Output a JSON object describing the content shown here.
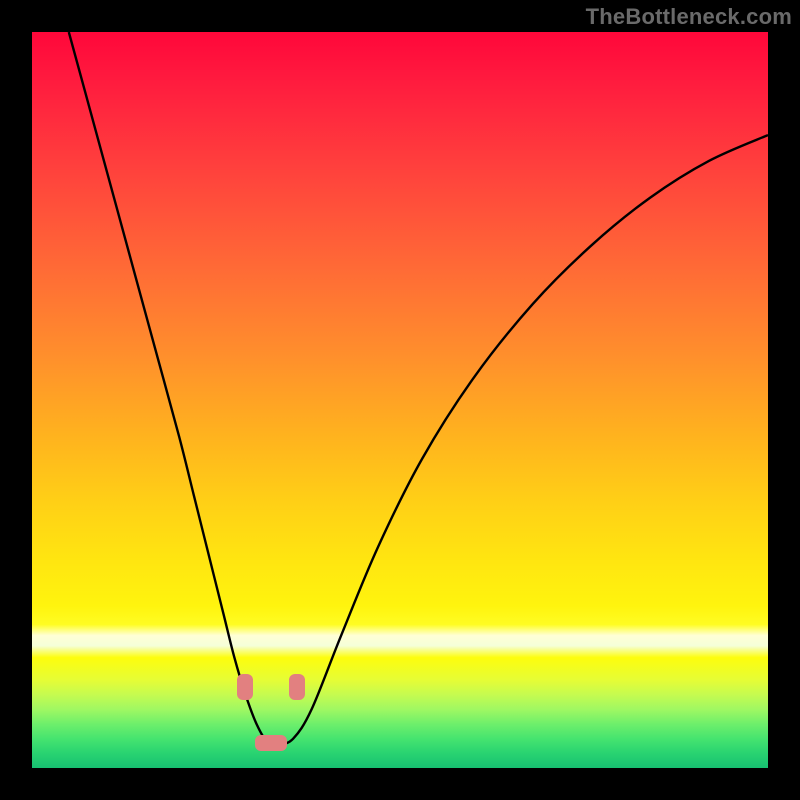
{
  "watermark": "TheBottleneck.com",
  "chart_data": {
    "type": "line",
    "title": "",
    "xlabel": "",
    "ylabel": "",
    "xlim": [
      0,
      100
    ],
    "ylim": [
      0,
      100
    ],
    "grid": false,
    "legend": false,
    "series": [
      {
        "name": "bottleneck-curve",
        "x": [
          5,
          8,
          11,
          14,
          17,
          20,
          22,
          24,
          26,
          27.5,
          29,
          30.5,
          32,
          33.5,
          35.5,
          38,
          42,
          47,
          53,
          60,
          68,
          76,
          84,
          92,
          100
        ],
        "y": [
          100,
          89,
          78,
          67,
          56,
          45,
          37,
          29,
          21,
          15,
          10,
          6,
          3.5,
          3.2,
          4,
          8,
          18,
          30,
          42,
          53,
          63,
          71,
          77.5,
          82.5,
          86
        ]
      }
    ],
    "annotations": [
      {
        "name": "marker-left",
        "shape": "rounded",
        "x": 29.0,
        "y": 11.0,
        "color": "#e28080"
      },
      {
        "name": "marker-bottom",
        "shape": "rounded",
        "x": 32.5,
        "y": 3.4,
        "color": "#e28080"
      },
      {
        "name": "marker-right",
        "shape": "rounded",
        "x": 36.0,
        "y": 11.0,
        "color": "#e28080"
      }
    ],
    "background_bands": [
      {
        "from_y": 100,
        "to_y": 20,
        "color_top": "#ff073a",
        "color_bottom": "#fffc22"
      },
      {
        "from_y": 20,
        "to_y": 18.5,
        "color": "#ffff90"
      },
      {
        "from_y": 18.5,
        "to_y": 16,
        "color": "#ffffe0"
      },
      {
        "from_y": 16,
        "to_y": 10,
        "color": "#d8fb57"
      },
      {
        "from_y": 10,
        "to_y": 4,
        "color": "#57e66f"
      },
      {
        "from_y": 4,
        "to_y": 0,
        "color": "#17c071"
      }
    ]
  }
}
